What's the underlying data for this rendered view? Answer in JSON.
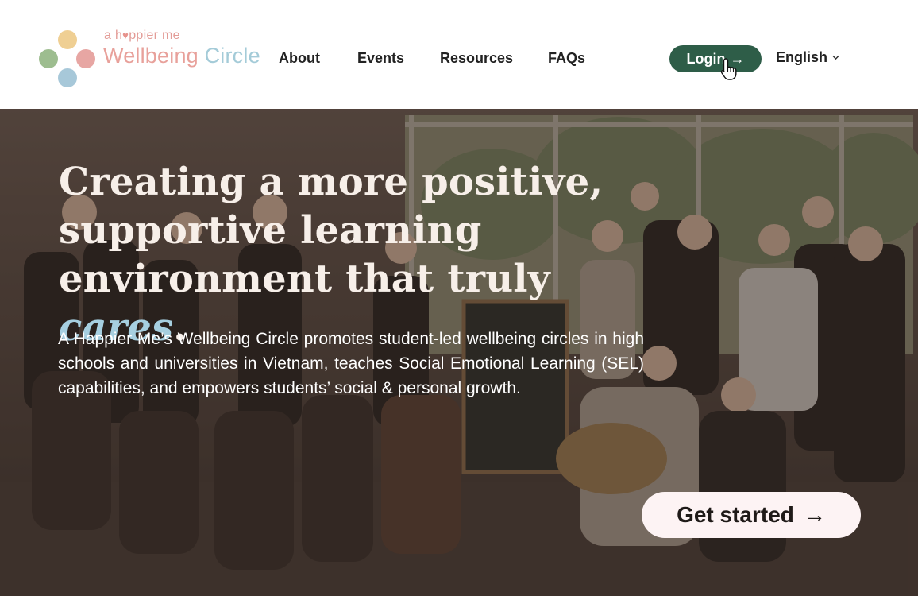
{
  "header": {
    "logo": {
      "tagline_prefix": "a h",
      "tagline_heart": "♥",
      "tagline_suffix": "ppier me",
      "brand_word1": "Wellbeing",
      "brand_word2": "Circle",
      "colors": {
        "yellow": "#efcf93",
        "green": "#9dbd8f",
        "pink": "#e7a6a3",
        "blue": "#a7c8d9"
      }
    },
    "nav": [
      "About",
      "Events",
      "Resources",
      "FAQs"
    ],
    "login": {
      "label": "Login",
      "arrow": "→",
      "color": "#2e5d48"
    },
    "language": {
      "selected": "English",
      "icon": "chevron-down-icon"
    }
  },
  "hero": {
    "headline_part1": "Creating a more positive, supportive learning environment that truly",
    "headline_accent": "cares",
    "headline_end": ".",
    "description": "A Happier Me’s Wellbeing Circle promotes student-led wellbeing circles in high schools and universities in Vietnam, teaches Social Emotional Learning (SEL) capabilities, and empowers students’ social & personal growth.",
    "cta": {
      "label": "Get started",
      "arrow": "→"
    },
    "accent_color": "#a6cfe0"
  }
}
